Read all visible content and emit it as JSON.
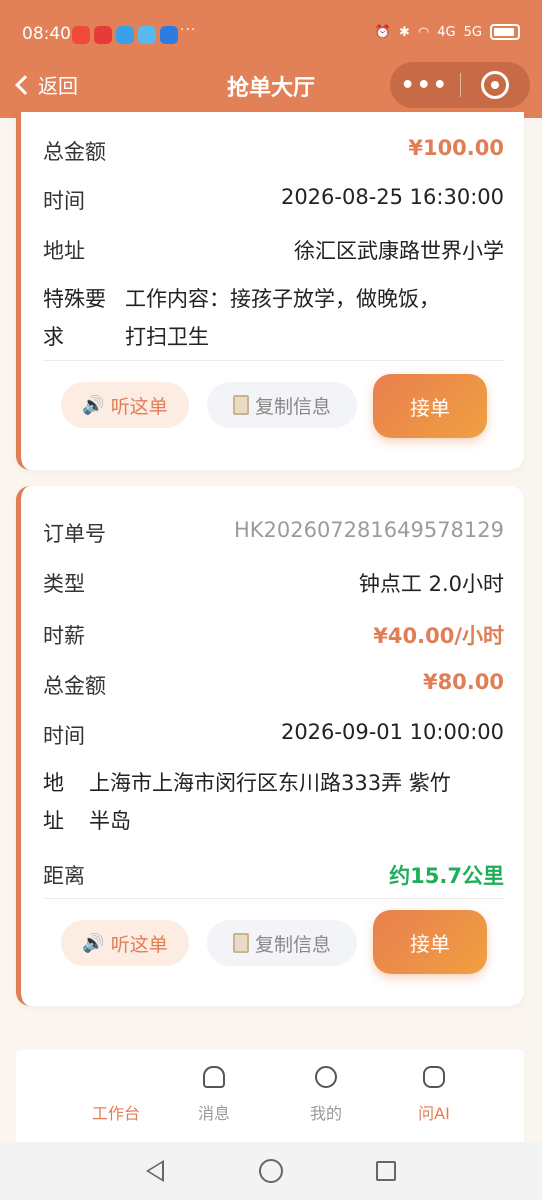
{
  "status_bar": {
    "time": "08:40",
    "more": "···",
    "signal_a": "4G",
    "signal_b": "5G"
  },
  "nav": {
    "back_label": "返回",
    "title": "抢单大厅",
    "more_glyph": "•••"
  },
  "order1": {
    "total_label": "总金额",
    "total_value": "¥100.00",
    "time_label": "时间",
    "time_value": "2026-08-25 16:30:00",
    "addr_label": "地址",
    "addr_value": "徐汇区武康路世界小学",
    "special_label_1": "特殊要",
    "special_label_2": "求",
    "special_value_1": "工作内容：接孩子放学，做晚饭，",
    "special_value_2": "打扫卫生",
    "listen_label": "听这单",
    "copy_label": "复制信息",
    "take_label": "接单"
  },
  "order2": {
    "id_label": "订单号",
    "id_value": "HK202607281649578129",
    "type_label": "类型",
    "type_value": "钟点工 2.0小时",
    "rate_label": "时薪",
    "rate_value": "¥40.00/小时",
    "total_label": "总金额",
    "total_value": "¥80.00",
    "time_label": "时间",
    "time_value": "2026-09-01 10:00:00",
    "addr_label_1": "地",
    "addr_label_2": "址",
    "addr_value_1": "上海市上海市闵行区东川路333弄 紫竹",
    "addr_value_2": "半岛",
    "dist_label": "距离",
    "dist_value": "约15.7公里",
    "listen_label": "听这单",
    "copy_label": "复制信息",
    "take_label": "接单"
  },
  "tabbar": {
    "items": [
      {
        "label": "工作台",
        "icon": "workbench-icon",
        "active": true
      },
      {
        "label": "消息",
        "icon": "bell-icon",
        "active": false
      },
      {
        "label": "我的",
        "icon": "user-icon",
        "active": false
      },
      {
        "label": "问AI",
        "icon": "chat-icon",
        "active": false
      }
    ]
  },
  "colors": {
    "accent": "#e07e55",
    "green": "#1fae5a"
  }
}
